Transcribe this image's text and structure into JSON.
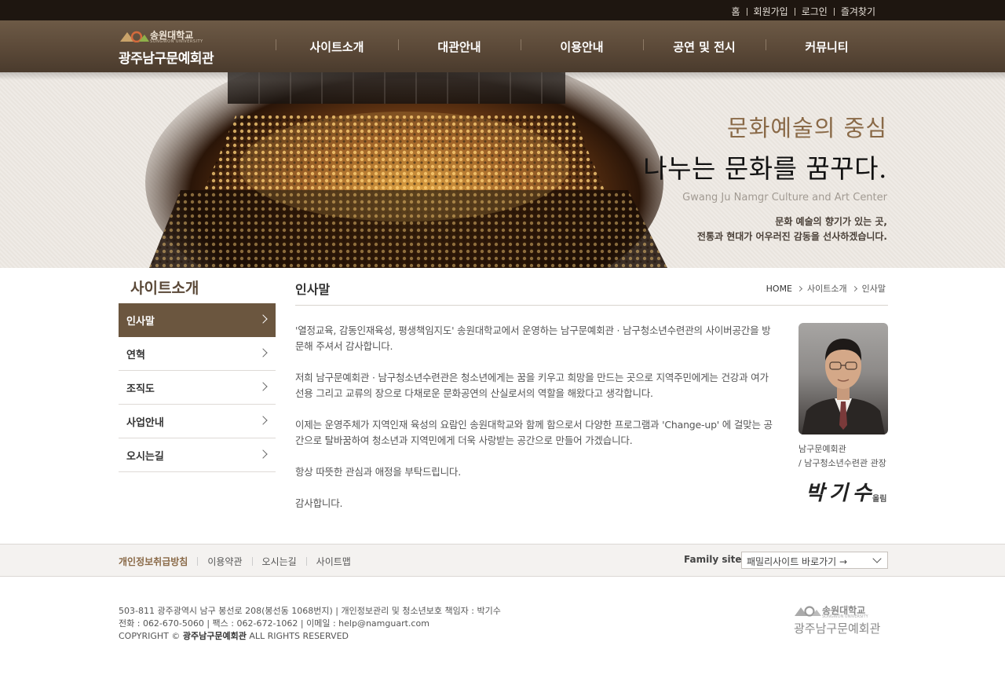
{
  "top_links": [
    "홈",
    "회원가입",
    "로그인",
    "즐겨찾기"
  ],
  "logo": {
    "univ": "송원대학교",
    "univ_en": "SONGWON UNIVERSITY",
    "site": "광주남구문예회관"
  },
  "gnb": [
    "사이트소개",
    "대관안내",
    "이용안내",
    "공연 및 전시",
    "커뮤니티"
  ],
  "visual": {
    "line1": "문화예술의 중심",
    "line2": "나누는 문화를 꿈꾸다.",
    "line3": "Gwang Ju Namgr Culture and Art Center",
    "line4a": "문화 예술의 향기가 있는 곳,",
    "line4b": "전통과 현대가 어우러진 감동을 선사하겠습니다."
  },
  "lnb": {
    "title": "사이트소개",
    "items": [
      "인사말",
      "연혁",
      "조직도",
      "사업안내",
      "오시는길"
    ],
    "active_index": 0
  },
  "content": {
    "title": "인사말",
    "breadcrumb": [
      "HOME",
      "사이트소개",
      "인사말"
    ],
    "paragraphs": [
      "'열정교육, 감동인재육성, 평생책임지도' 송원대학교에서 운영하는 남구문예회관 · 남구청소년수련관의 사이버공간을 방문해 주셔서 감사합니다.",
      "저희 남구문예회관 · 남구청소년수련관은 청소년에게는 꿈을 키우고 희망을 만드는 곳으로 지역주민에게는 건강과 여가 선용 그리고 교류의 장으로 다채로운 문화공연의 산실로서의 역할을 해왔다고 생각합니다.",
      "이제는 운영주체가 지역인재 육성의 요람인 송원대학교와 함께 함으로서 다양한 프로그램과 'Change-up' 에 걸맞는 공간으로 탈바꿈하여 청소년과 지역민에게 더욱 사랑받는 공간으로 만들어 가겠습니다.",
      "항상 따뜻한 관심과 애정을 부탁드립니다.",
      "감사합니다."
    ],
    "caption_line1": "남구문예회관",
    "caption_line2": "/ 남구청소년수련관 관장",
    "signature": "박기수",
    "signature_suffix": "올림"
  },
  "footer_links": [
    "개인정보취급방침",
    "이용약관",
    "오시는길",
    "사이트맵"
  ],
  "family_site": {
    "label": "Family site",
    "selected": "패밀리사이트 바로가기 →"
  },
  "footer_info": {
    "line1": "503-811 광주광역시 남구 봉선로 208(봉선동 1068번지) | 개인정보관리 및 청소년보호 책임자 : 박기수",
    "line2": "전화 : 062-670-5060 | 팩스 : 062-672-1062 | 이메일 : help@namguart.com",
    "line3_prefix": "COPYRIGHT © ",
    "line3_bold": "광주남구문예회관",
    "line3_suffix": " ALL RIGHTS RESERVED"
  },
  "colors": {
    "accent": "#6b563f",
    "header": "#5b4938",
    "topbar": "#1e1610",
    "highlight": "#8a6a48"
  }
}
